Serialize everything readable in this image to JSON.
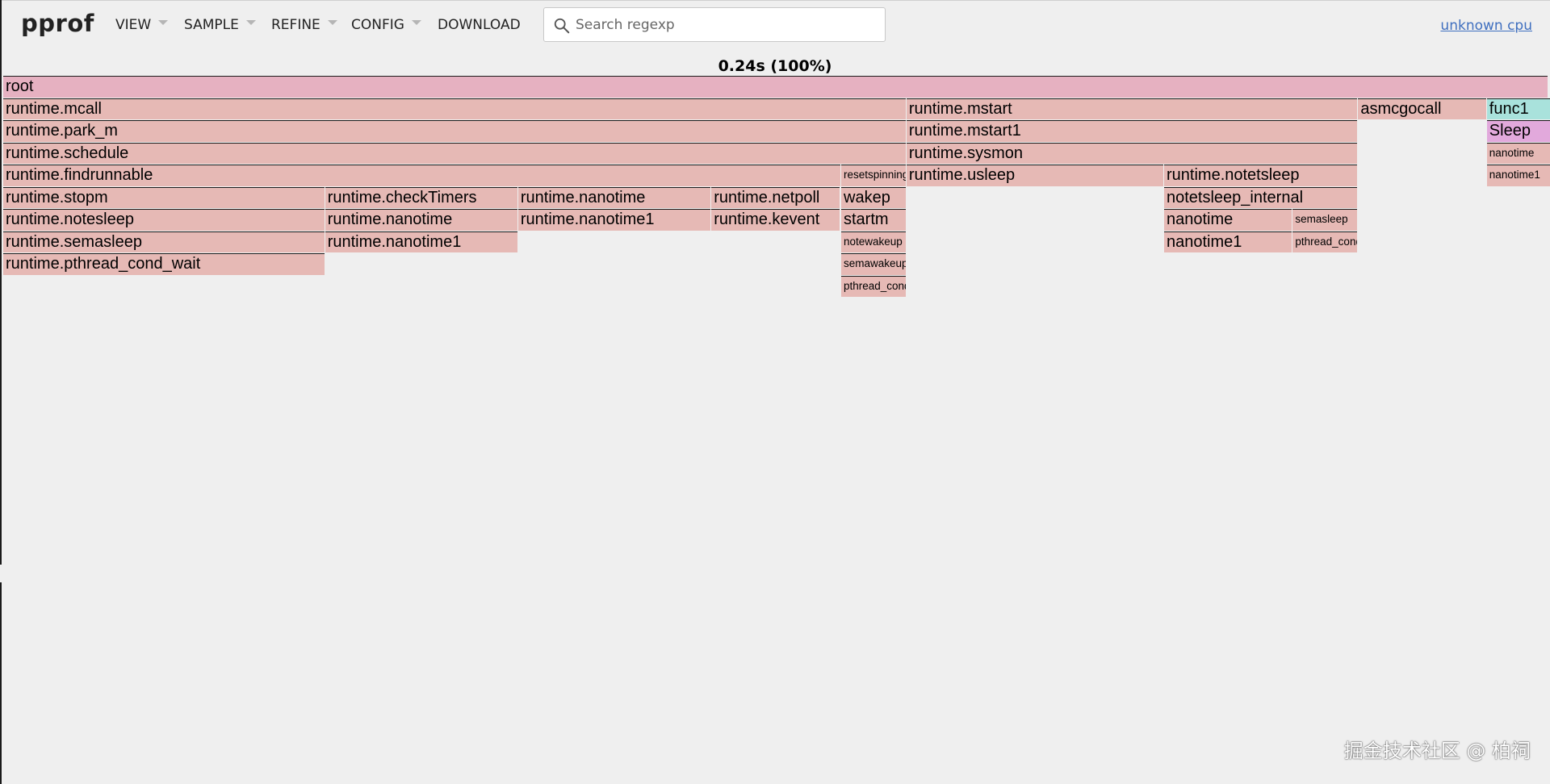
{
  "app": {
    "logo": "pprof",
    "menu": [
      {
        "id": "view",
        "label": "VIEW",
        "has_caret": true
      },
      {
        "id": "sample",
        "label": "SAMPLE",
        "has_caret": true
      },
      {
        "id": "refine",
        "label": "REFINE",
        "has_caret": true
      },
      {
        "id": "config",
        "label": "CONFIG",
        "has_caret": true
      },
      {
        "id": "download",
        "label": "DOWNLOAD",
        "has_caret": false
      }
    ],
    "search": {
      "placeholder": "Search regexp",
      "value": ""
    },
    "profile_link": "unknown cpu"
  },
  "flamegraph": {
    "title": "0.24s (100%)",
    "colors": {
      "root": "#e6b1c1",
      "default": "#e6b9b5",
      "func1": "#a9e2dc",
      "sleep": "#e2a9dc"
    },
    "frames": [
      {
        "id": "root",
        "label": "root",
        "depth": 0,
        "start": 0.0,
        "share": 1.0,
        "color": "root",
        "size": "big"
      },
      {
        "id": "mcall",
        "label": "runtime.mcall",
        "depth": 1,
        "start": 0.0,
        "share": 0.5846,
        "color": "default",
        "size": "big"
      },
      {
        "id": "park_m",
        "label": "runtime.park_m",
        "depth": 2,
        "start": 0.0,
        "share": 0.5846,
        "color": "default",
        "size": "big"
      },
      {
        "id": "schedule",
        "label": "runtime.schedule",
        "depth": 3,
        "start": 0.0,
        "share": 0.5846,
        "color": "default",
        "size": "big"
      },
      {
        "id": "findrunnable",
        "label": "runtime.findrunnable",
        "depth": 4,
        "start": 0.0,
        "share": 0.5423,
        "color": "default",
        "size": "big"
      },
      {
        "id": "resetspinning",
        "label": "resetspinning",
        "depth": 4,
        "start": 0.5423,
        "share": 0.0423,
        "color": "default",
        "size": "small"
      },
      {
        "id": "stopm",
        "label": "runtime.stopm",
        "depth": 5,
        "start": 0.0,
        "share": 0.2083,
        "color": "default",
        "size": "big"
      },
      {
        "id": "checkTimers",
        "label": "runtime.checkTimers",
        "depth": 5,
        "start": 0.2083,
        "share": 0.125,
        "color": "default",
        "size": "big"
      },
      {
        "id": "nanotime_a",
        "label": "runtime.nanotime",
        "depth": 5,
        "start": 0.3333,
        "share": 0.125,
        "color": "default",
        "size": "big"
      },
      {
        "id": "netpoll",
        "label": "runtime.netpoll",
        "depth": 5,
        "start": 0.4583,
        "share": 0.0833,
        "color": "default",
        "size": "big"
      },
      {
        "id": "wakep",
        "label": "wakep",
        "depth": 5,
        "start": 0.5423,
        "share": 0.0423,
        "color": "default",
        "size": "big"
      },
      {
        "id": "notesleep",
        "label": "runtime.notesleep",
        "depth": 6,
        "start": 0.0,
        "share": 0.2083,
        "color": "default",
        "size": "big"
      },
      {
        "id": "nanotime_b",
        "label": "runtime.nanotime",
        "depth": 6,
        "start": 0.2083,
        "share": 0.125,
        "color": "default",
        "size": "big"
      },
      {
        "id": "nanotime1_a",
        "label": "runtime.nanotime1",
        "depth": 6,
        "start": 0.3333,
        "share": 0.125,
        "color": "default",
        "size": "big"
      },
      {
        "id": "kevent",
        "label": "runtime.kevent",
        "depth": 6,
        "start": 0.4583,
        "share": 0.0833,
        "color": "default",
        "size": "big"
      },
      {
        "id": "startm",
        "label": "startm",
        "depth": 6,
        "start": 0.5423,
        "share": 0.0423,
        "color": "default",
        "size": "big"
      },
      {
        "id": "semasleep",
        "label": "runtime.semasleep",
        "depth": 7,
        "start": 0.0,
        "share": 0.2083,
        "color": "default",
        "size": "big"
      },
      {
        "id": "nanotime1_b",
        "label": "runtime.nanotime1",
        "depth": 7,
        "start": 0.2083,
        "share": 0.125,
        "color": "default",
        "size": "big"
      },
      {
        "id": "notewakeup",
        "label": "notewakeup",
        "depth": 7,
        "start": 0.5423,
        "share": 0.0423,
        "color": "default",
        "size": "small"
      },
      {
        "id": "pthread_cond_wait",
        "label": "runtime.pthread_cond_wait",
        "depth": 8,
        "start": 0.0,
        "share": 0.2083,
        "color": "default",
        "size": "big"
      },
      {
        "id": "semawakeup",
        "label": "semawakeup",
        "depth": 8,
        "start": 0.5423,
        "share": 0.0423,
        "color": "default",
        "size": "small"
      },
      {
        "id": "pthread_cond_signal",
        "label": "pthread_cond_signal",
        "depth": 9,
        "start": 0.5423,
        "share": 0.0423,
        "color": "default",
        "size": "small"
      },
      {
        "id": "mstart",
        "label": "runtime.mstart",
        "depth": 1,
        "start": 0.5846,
        "share": 0.2923,
        "color": "default",
        "size": "big"
      },
      {
        "id": "mstart1",
        "label": "runtime.mstart1",
        "depth": 2,
        "start": 0.5846,
        "share": 0.2923,
        "color": "default",
        "size": "big"
      },
      {
        "id": "sysmon",
        "label": "runtime.sysmon",
        "depth": 3,
        "start": 0.5846,
        "share": 0.2923,
        "color": "default",
        "size": "big"
      },
      {
        "id": "usleep",
        "label": "runtime.usleep",
        "depth": 4,
        "start": 0.5846,
        "share": 0.1667,
        "color": "default",
        "size": "big"
      },
      {
        "id": "notetsleep",
        "label": "runtime.notetsleep",
        "depth": 4,
        "start": 0.7513,
        "share": 0.1256,
        "color": "default",
        "size": "big"
      },
      {
        "id": "notetsleep_internal",
        "label": "notetsleep_internal",
        "depth": 5,
        "start": 0.7513,
        "share": 0.1256,
        "color": "default",
        "size": "big"
      },
      {
        "id": "nanotime_c",
        "label": "nanotime",
        "depth": 6,
        "start": 0.7513,
        "share": 0.0833,
        "color": "default",
        "size": "big"
      },
      {
        "id": "semasleep2",
        "label": "semasleep",
        "depth": 6,
        "start": 0.8346,
        "share": 0.0423,
        "color": "default",
        "size": "small"
      },
      {
        "id": "nanotime1_c",
        "label": "nanotime1",
        "depth": 7,
        "start": 0.7513,
        "share": 0.0833,
        "color": "default",
        "size": "big"
      },
      {
        "id": "pthread_cond2",
        "label": "pthread_cond_timedwait_relative_np",
        "depth": 7,
        "start": 0.8346,
        "share": 0.0423,
        "color": "default",
        "size": "small"
      },
      {
        "id": "asmcgocall",
        "label": "asmcgocall",
        "depth": 1,
        "start": 0.8769,
        "share": 0.0833,
        "color": "default",
        "size": "big"
      },
      {
        "id": "func1",
        "label": "func1",
        "depth": 1,
        "start": 0.9602,
        "share": 0.0417,
        "color": "func1",
        "size": "big"
      },
      {
        "id": "sleep",
        "label": "Sleep",
        "depth": 2,
        "start": 0.9602,
        "share": 0.0417,
        "color": "sleep",
        "size": "big"
      },
      {
        "id": "nanotime_d",
        "label": "nanotime",
        "depth": 3,
        "start": 0.9602,
        "share": 0.0417,
        "color": "default",
        "size": "small"
      },
      {
        "id": "nanotime1_d",
        "label": "nanotime1",
        "depth": 4,
        "start": 0.9602,
        "share": 0.0417,
        "color": "default",
        "size": "small"
      }
    ]
  },
  "watermark": "掘金技术社区 @ 柏祠"
}
